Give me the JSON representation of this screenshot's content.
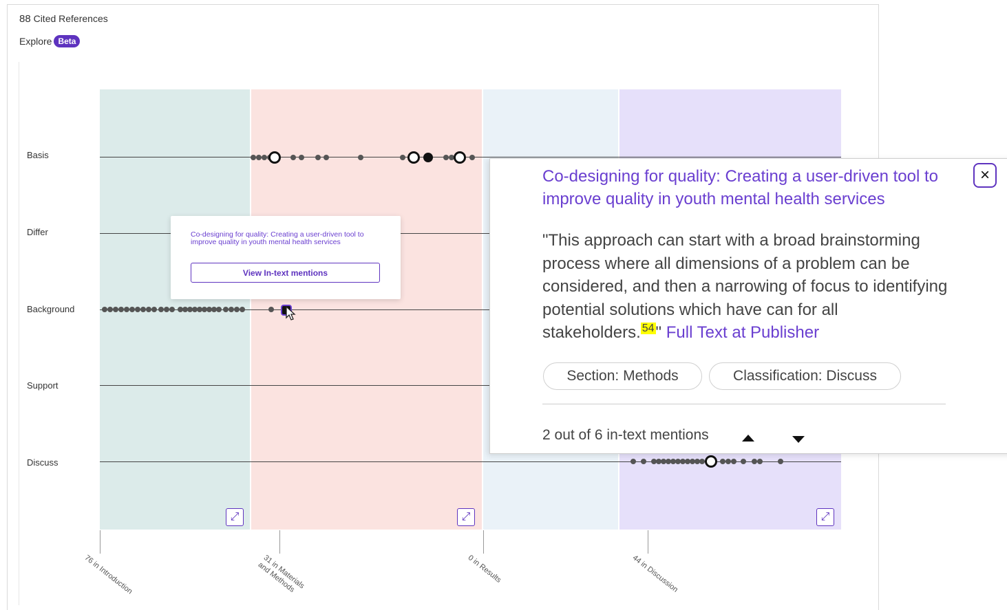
{
  "header": {
    "count": "88",
    "count_label": "Cited References",
    "explore_label": "Explore",
    "beta_badge": "Beta"
  },
  "chart": {
    "rows": [
      "Basis",
      "Differ",
      "Background",
      "Support",
      "Discuss"
    ],
    "sections": [
      {
        "label": "76 in Introduction",
        "color": "#dcebea"
      },
      {
        "label": "31 in Materials and Methods",
        "color": "#fbe3e0"
      },
      {
        "label": "0 in Results",
        "color": "#eaf2f8"
      },
      {
        "label": "44 in Discussion",
        "color": "#e6e0fa"
      }
    ]
  },
  "mini_popup": {
    "title": "Co-designing for quality: Creating a user-driven tool to improve quality in youth mental health services",
    "button": "View In-text mentions"
  },
  "panel": {
    "title": "Co-designing for quality: Creating a user-driven tool to improve quality in youth mental health services",
    "close_icon": "×",
    "quote_text": "\"This approach can start with a broad brainstorming process where all dimensions of a problem can be considered, and then a narrowing of focus to identifying potential solutions which have can for all stakeholders.",
    "citation_num": "54",
    "quote_close": "\"",
    "full_text_link": "Full Text at Publisher",
    "section_tag": "Section: Methods",
    "classification_tag": "Classification: Discuss",
    "mentions": "2 out of 6 in-text mentions"
  }
}
